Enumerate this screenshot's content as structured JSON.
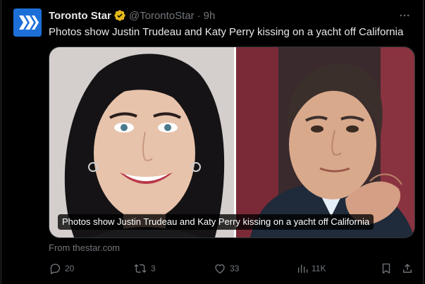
{
  "tweet": {
    "author_name": "Toronto Star",
    "handle": "@TorontoStar",
    "separator": "·",
    "time": "9h",
    "text": "Photos show Justin Trudeau and Katy Perry kissing on a yacht off California",
    "verified_badge_color": "#e2b719"
  },
  "card": {
    "caption": "Photos show Justin Trudeau and Katy Perry kissing on a yacht off California",
    "source": "From thestar.com"
  },
  "actions": {
    "replies": "20",
    "retweets": "3",
    "likes": "33",
    "views": "11K"
  },
  "colors": {
    "background": "#000000",
    "text_primary": "#e7e9ea",
    "text_secondary": "#71767b",
    "border": "#2f3336",
    "avatar_brand": "#1d6fd8"
  },
  "icons": {
    "more": "more-icon",
    "reply": "reply-icon",
    "retweet": "retweet-icon",
    "like": "like-icon",
    "views": "views-icon",
    "bookmark": "bookmark-icon",
    "share": "share-icon"
  }
}
